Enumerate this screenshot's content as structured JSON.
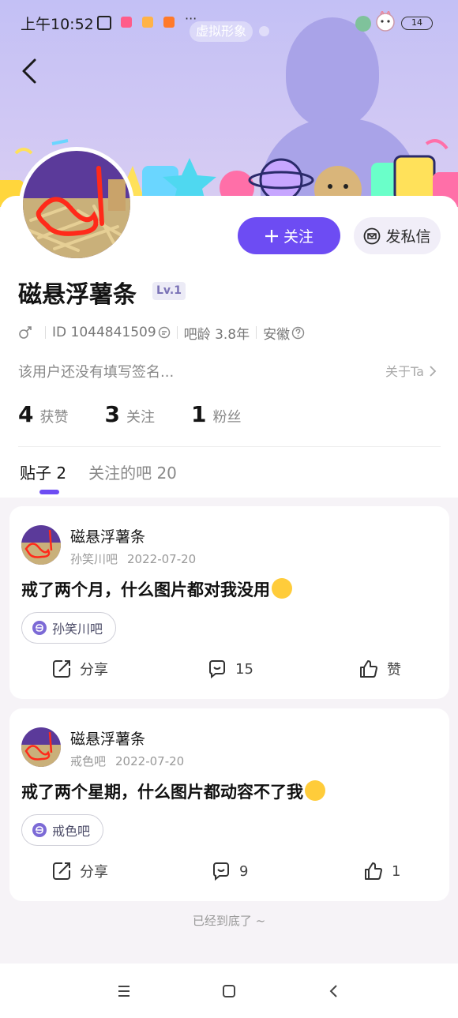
{
  "status_bar": {
    "time": "上午10:52",
    "battery": "14",
    "dots": "···"
  },
  "header": {
    "virtual_avatar_label": "虚拟形象"
  },
  "profile": {
    "username": "磁悬浮薯条",
    "level": "Lv.1",
    "gender_icon": "male-icon",
    "user_id": "ID 1044841509",
    "bar_age": "吧龄 3.8年",
    "location": "安徽",
    "signature": "该用户还没有填写签名...",
    "about_label": "关于Ta",
    "follow_label": "关注",
    "message_label": "发私信",
    "stats": [
      {
        "num": "4",
        "label": "获赞"
      },
      {
        "num": "3",
        "label": "关注"
      },
      {
        "num": "1",
        "label": "粉丝"
      }
    ]
  },
  "tabs": [
    {
      "label": "贴子 2"
    },
    {
      "label": "关注的吧 20"
    }
  ],
  "posts": [
    {
      "author": "磁悬浮薯条",
      "forum": "孙笑川吧",
      "date": "2022-07-20",
      "title": "戒了两个月，什么图片都对我没用",
      "tag": "孙笑川吧",
      "share_label": "分享",
      "comments": "15",
      "likes": "赞"
    },
    {
      "author": "磁悬浮薯条",
      "forum": "戒色吧",
      "date": "2022-07-20",
      "title": "戒了两个星期，什么图片都动容不了我",
      "tag": "戒色吧",
      "share_label": "分享",
      "comments": "9",
      "likes": "1"
    }
  ],
  "end_note": "已经到底了 ~",
  "colors": {
    "accent": "#6d4cf3",
    "banner": "#c3c0f5"
  }
}
